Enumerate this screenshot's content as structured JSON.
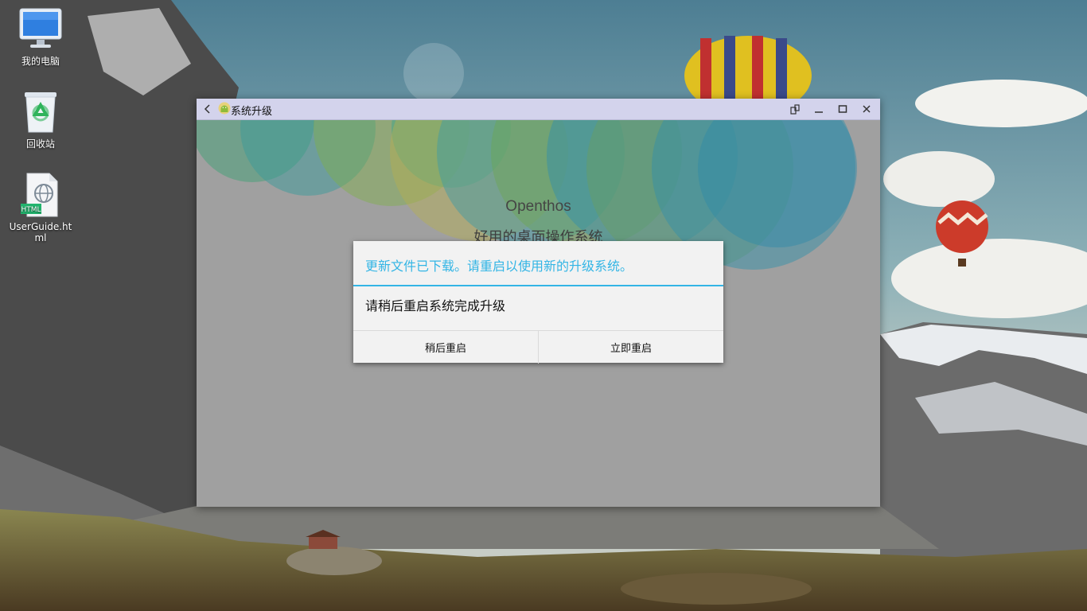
{
  "desktop": {
    "icons": [
      {
        "label": "我的电脑",
        "icon": "computer-icon"
      },
      {
        "label": "回收站",
        "icon": "recycle-bin-icon"
      },
      {
        "label": "UserGuide.html",
        "icon": "html-file-icon",
        "badge": "HTML"
      }
    ]
  },
  "window": {
    "title": "系统升级",
    "icon": "android-app-icon",
    "controls": [
      "back-icon",
      "rotate-icon",
      "minimize-icon",
      "maximize-icon",
      "close-icon"
    ],
    "app_name": "Openthos",
    "slogan": "好用的桌面操作系统"
  },
  "dialog": {
    "title": "更新文件已下载。请重启以使用新的升级系统。",
    "message": "请稍后重启系统完成升级",
    "later_button": "稍后重启",
    "now_button": "立即重启"
  },
  "colors": {
    "accent": "#33b5e5",
    "titlebar": "#d3d3ec",
    "window_content": "#a0a0a0",
    "dialog_bg": "#f2f2f2"
  }
}
